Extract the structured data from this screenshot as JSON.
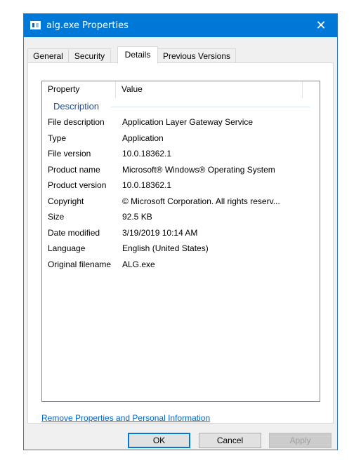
{
  "window": {
    "title": "alg.exe Properties",
    "close_glyph": "✕"
  },
  "tabs": [
    {
      "label": "General",
      "active": false
    },
    {
      "label": "Security",
      "active": false
    },
    {
      "label": "Details",
      "active": true
    },
    {
      "label": "Previous Versions",
      "active": false
    }
  ],
  "details": {
    "columns": {
      "property": "Property",
      "value": "Value"
    },
    "group": "Description",
    "rows": [
      {
        "property": "File description",
        "value": "Application Layer Gateway Service"
      },
      {
        "property": "Type",
        "value": "Application"
      },
      {
        "property": "File version",
        "value": "10.0.18362.1"
      },
      {
        "property": "Product name",
        "value": "Microsoft® Windows® Operating System"
      },
      {
        "property": "Product version",
        "value": "10.0.18362.1"
      },
      {
        "property": "Copyright",
        "value": "© Microsoft Corporation. All rights reserv..."
      },
      {
        "property": "Size",
        "value": "92.5 KB"
      },
      {
        "property": "Date modified",
        "value": "3/19/2019 10:14 AM"
      },
      {
        "property": "Language",
        "value": "English (United States)"
      },
      {
        "property": "Original filename",
        "value": "ALG.exe"
      }
    ]
  },
  "link": {
    "label": "Remove Properties and Personal Information"
  },
  "buttons": {
    "ok": "OK",
    "cancel": "Cancel",
    "apply": "Apply"
  },
  "colors": {
    "titlebar": "#0078d7",
    "link": "#0066cc",
    "group_header": "#1e4e9c"
  }
}
